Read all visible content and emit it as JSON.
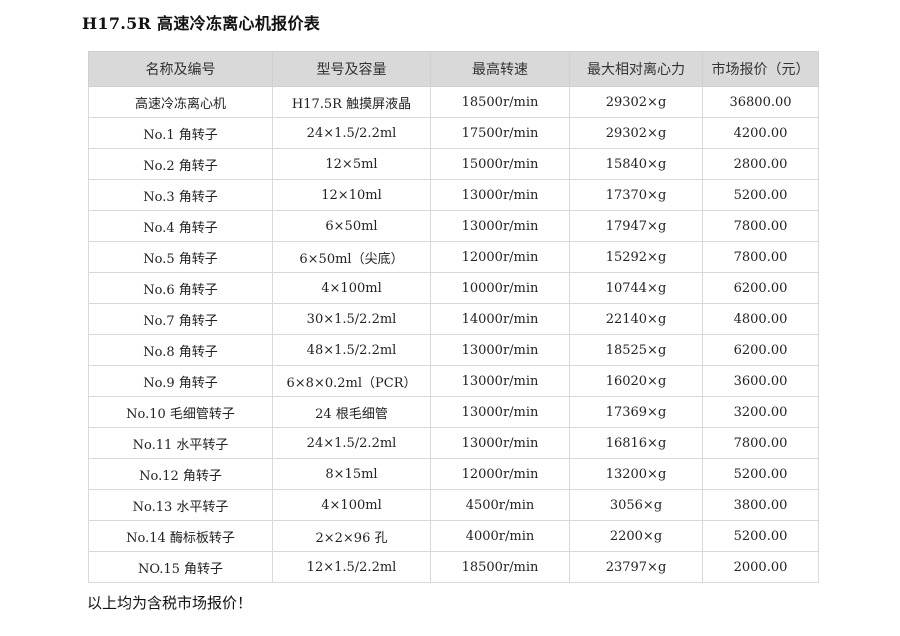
{
  "document": {
    "title": "H17.5R 高速冷冻离心机报价表",
    "footer_note": "以上均为含税市场报价！"
  },
  "table": {
    "headers": [
      "名称及编号",
      "型号及容量",
      "最高转速",
      "最大相对离心力",
      "市场报价（元）"
    ],
    "rows": [
      [
        "高速冷冻离心机",
        "H17.5R 触摸屏液晶",
        "18500r/min",
        "29302×g",
        "36800.00"
      ],
      [
        "No.1 角转子",
        "24×1.5/2.2ml",
        "17500r/min",
        "29302×g",
        "4200.00"
      ],
      [
        "No.2 角转子",
        "12×5ml",
        "15000r/min",
        "15840×g",
        "2800.00"
      ],
      [
        "No.3 角转子",
        "12×10ml",
        "13000r/min",
        "17370×g",
        "5200.00"
      ],
      [
        "No.4 角转子",
        "6×50ml",
        "13000r/min",
        "17947×g",
        "7800.00"
      ],
      [
        "No.5 角转子",
        "6×50ml（尖底）",
        "12000r/min",
        "15292×g",
        "7800.00"
      ],
      [
        "No.6 角转子",
        "4×100ml",
        "10000r/min",
        "10744×g",
        "6200.00"
      ],
      [
        "No.7 角转子",
        "30×1.5/2.2ml",
        "14000r/min",
        "22140×g",
        "4800.00"
      ],
      [
        "No.8 角转子",
        "48×1.5/2.2ml",
        "13000r/min",
        "18525×g",
        "6200.00"
      ],
      [
        "No.9 角转子",
        "6×8×0.2ml（PCR）",
        "13000r/min",
        "16020×g",
        "3600.00"
      ],
      [
        "No.10 毛细管转子",
        "24 根毛细管",
        "13000r/min",
        "17369×g",
        "3200.00"
      ],
      [
        "No.11 水平转子",
        "24×1.5/2.2ml",
        "13000r/min",
        "16816×g",
        "7800.00"
      ],
      [
        "No.12 角转子",
        "8×15ml",
        "12000r/min",
        "13200×g",
        "5200.00"
      ],
      [
        "No.13 水平转子",
        "4×100ml",
        "4500r/min",
        "3056×g",
        "3800.00"
      ],
      [
        "No.14 酶标板转子",
        "2×2×96 孔",
        "4000r/min",
        "2200×g",
        "5200.00"
      ],
      [
        "NO.15 角转子",
        "12×1.5/2.2ml",
        "18500r/min",
        "23797×g",
        "2000.00"
      ]
    ]
  }
}
